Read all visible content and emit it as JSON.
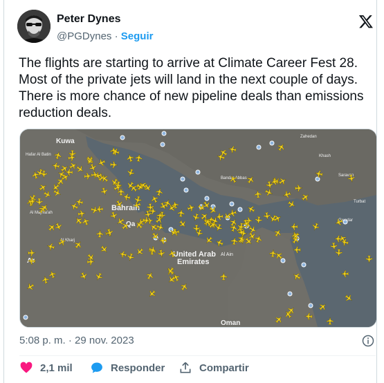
{
  "author": {
    "name": "Peter Dynes",
    "handle": "@PGDynes",
    "separator": "·",
    "follow_label": "Seguir"
  },
  "tweet": {
    "lines": [
      "The flights are starting to arrive at Climate Career Fest 28.",
      "Most of the private jets will land in the next couple of days.",
      "There is more chance of new pipeline deals than emissions",
      "reduction deals."
    ]
  },
  "map": {
    "labels": {
      "kuwait": "Kuwa",
      "hafar": "Hafar Al Batin",
      "bahrain": "Bahrain",
      "qatar": "Qa",
      "uae1": "United Arab",
      "uae2": "Emirates",
      "oman": "Oman",
      "majmaah": "Al Majma'ah",
      "kharj": "Al Kharj",
      "riyadh": "Ar",
      "bandar": "Bandar Abbas",
      "zahedan": "Zahedan",
      "khash": "Khash",
      "saravan": "Saravan",
      "turbat": "Turbat",
      "gwadar": "Gwadar",
      "ain": "Al Ain"
    },
    "colors": {
      "sea": "#5b6770",
      "land": "#6f6e68",
      "plane": "#f3d21b",
      "airport": "#8fb5de"
    }
  },
  "meta": {
    "timestamp": "5:08 p. m. · 29 nov. 2023"
  },
  "actions": {
    "likes": "2,1 mil",
    "reply_label": "Responder",
    "share_label": "Compartir"
  },
  "colors": {
    "accent": "#1d9bf0",
    "like": "#f91880",
    "muted": "#536471"
  }
}
